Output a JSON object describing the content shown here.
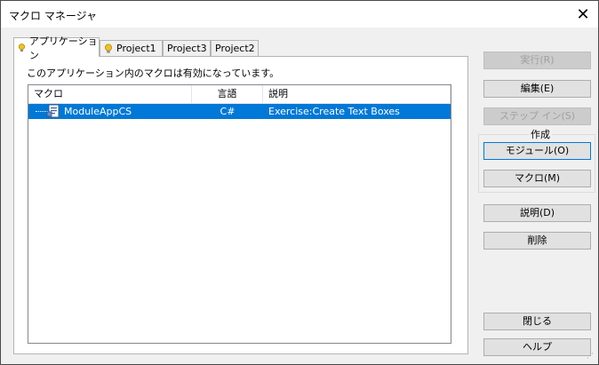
{
  "window": {
    "title": "マクロ マネージャ"
  },
  "tabs": [
    {
      "label": "アプリケーション",
      "icon": "bulb-icon"
    },
    {
      "label": "Project1",
      "icon": "bulb-icon"
    },
    {
      "label": "Project3"
    },
    {
      "label": "Project2"
    }
  ],
  "panel": {
    "description": "このアプリケーション内のマクロは有効になっています。"
  },
  "list": {
    "columns": [
      "マクロ",
      "言語",
      "説明"
    ],
    "rows": [
      {
        "name": "ModuleAppCS",
        "language": "C#",
        "description": "Exercise:Create Text Boxes",
        "selected": true
      }
    ]
  },
  "buttons": {
    "run": "実行(R)",
    "edit": "編集(E)",
    "step_in": "ステップ イン(S)",
    "create_group": "作成",
    "module": "モジュール(O)",
    "macro": "マクロ(M)",
    "description": "説明(D)",
    "delete": "削除",
    "close": "閉じる",
    "help": "ヘルプ"
  },
  "colors": {
    "selection": "#0078d7",
    "bulb": "#f2c21b"
  }
}
